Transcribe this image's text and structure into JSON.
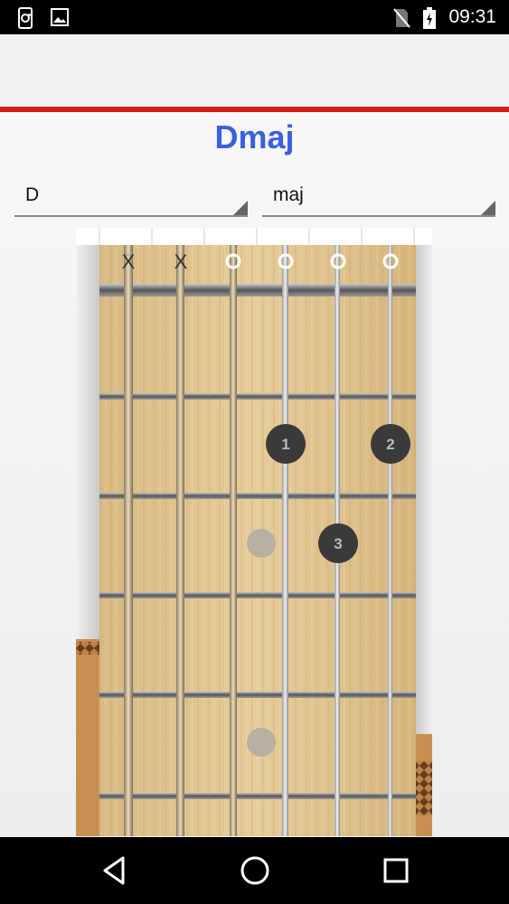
{
  "status_bar": {
    "time": "09:31",
    "left_icons": [
      "sync-screen-icon",
      "image-icon"
    ],
    "right_icons": [
      "no-sim-icon",
      "battery-icon"
    ]
  },
  "chord": {
    "title": "Dmaj",
    "root": "D",
    "quality": "maj"
  },
  "fretboard": {
    "open_markers": [
      "X",
      "X",
      "O",
      "O",
      "O",
      "O"
    ],
    "fingers": [
      {
        "string": 4,
        "fret": 2,
        "label": "1"
      },
      {
        "string": 6,
        "fret": 2,
        "label": "2"
      },
      {
        "string": 5,
        "fret": 3,
        "label": "3"
      }
    ],
    "inlay_frets": [
      3,
      5
    ]
  },
  "nav_bar": {
    "buttons": [
      "back-icon",
      "home-icon",
      "recents-icon"
    ]
  }
}
